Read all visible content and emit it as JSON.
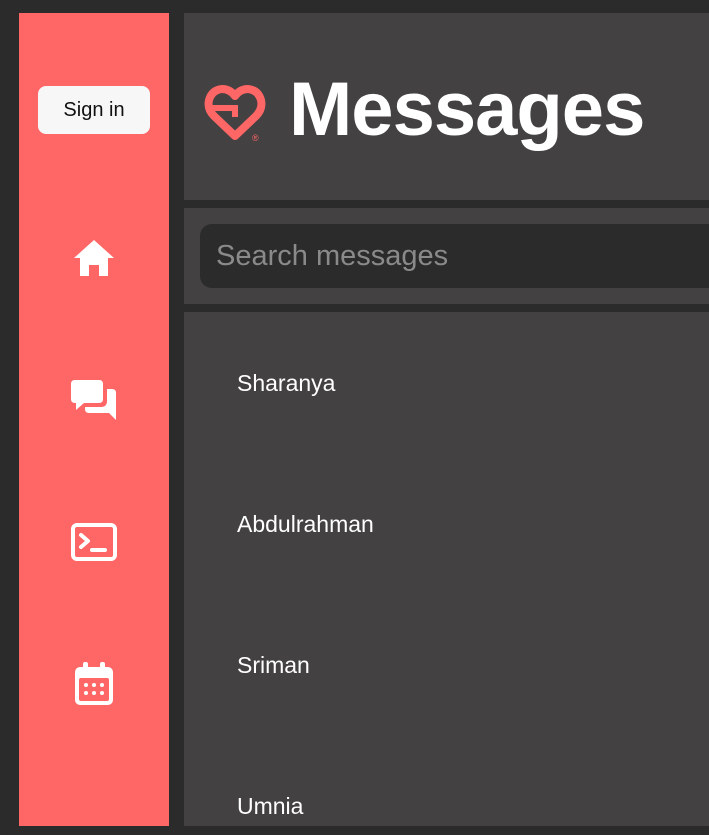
{
  "sidebar": {
    "sign_in_label": "Sign in",
    "nav": [
      {
        "icon": "home-icon"
      },
      {
        "icon": "chat-bubbles-icon"
      },
      {
        "icon": "terminal-icon"
      },
      {
        "icon": "calendar-icon"
      }
    ]
  },
  "header": {
    "title": "Messages",
    "logo_icon": "heart-logo-icon",
    "logo_mark": "®"
  },
  "search": {
    "placeholder": "Search messages",
    "value": ""
  },
  "messages": {
    "items": [
      {
        "name": "Sharanya"
      },
      {
        "name": "Abdulrahman"
      },
      {
        "name": "Sriman"
      },
      {
        "name": "Umnia"
      }
    ]
  },
  "colors": {
    "accent": "#ff6666",
    "panel": "#434142",
    "background": "#2b2b2b",
    "text": "#ffffff"
  }
}
